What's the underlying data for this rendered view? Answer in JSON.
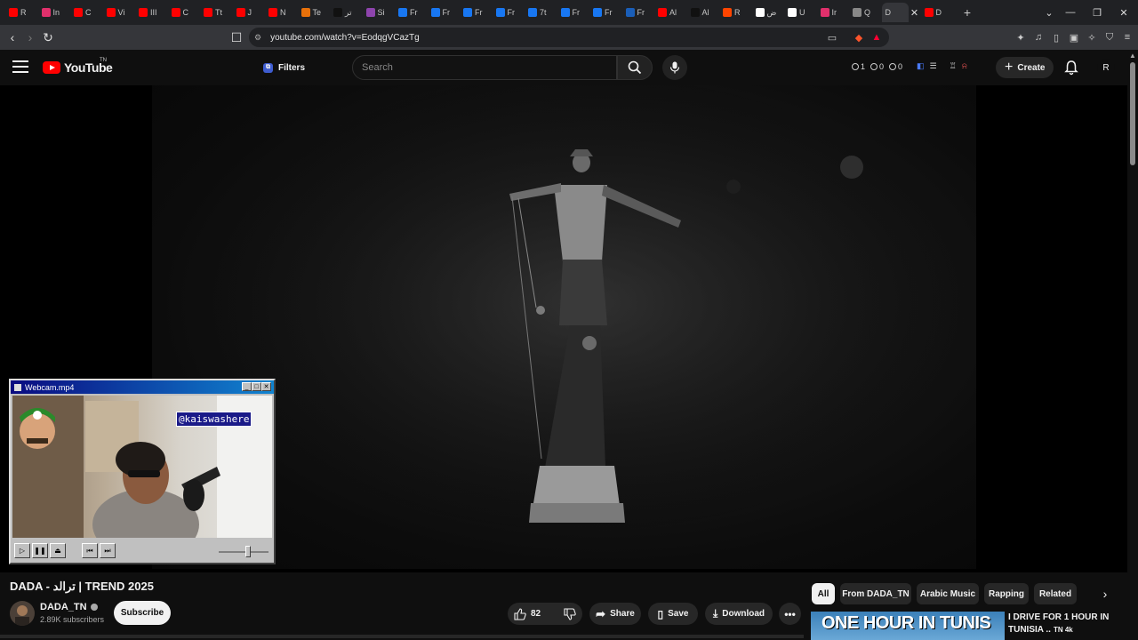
{
  "browser": {
    "tabs": [
      {
        "label": "R",
        "color": "#ff0000"
      },
      {
        "label": "In",
        "color": "#e1306c"
      },
      {
        "label": "C",
        "color": "#ff0000"
      },
      {
        "label": "Vi",
        "color": "#ff0000"
      },
      {
        "label": "III",
        "color": "#ff0000"
      },
      {
        "label": "C",
        "color": "#ff0000"
      },
      {
        "label": "Tt",
        "color": "#ff0000"
      },
      {
        "label": "J",
        "color": "#ff0000"
      },
      {
        "label": "N",
        "color": "#ff0000"
      },
      {
        "label": "Te",
        "color": "#e8710a"
      },
      {
        "label": "تر",
        "color": "#111111"
      },
      {
        "label": "Si",
        "color": "#8e44ad"
      },
      {
        "label": "Fr",
        "color": "#1877f2"
      },
      {
        "label": "Fr",
        "color": "#1877f2"
      },
      {
        "label": "Fr",
        "color": "#1877f2"
      },
      {
        "label": "Fr",
        "color": "#1877f2"
      },
      {
        "label": "7t",
        "color": "#1877f2"
      },
      {
        "label": "Fr",
        "color": "#1877f2"
      },
      {
        "label": "Fr",
        "color": "#1877f2"
      },
      {
        "label": "Fr",
        "color": "#1a5eb8"
      },
      {
        "label": "Al",
        "color": "#ff0000"
      },
      {
        "label": "Al",
        "color": "#111111"
      },
      {
        "label": "R",
        "color": "#ff4500"
      },
      {
        "label": "ض",
        "color": "#ffffff"
      },
      {
        "label": "U",
        "color": "#ffffff"
      },
      {
        "label": "Ir",
        "color": "#e1306c"
      },
      {
        "label": "Q",
        "color": "#888888"
      }
    ],
    "active_tab": {
      "label": "D"
    },
    "after_tab": {
      "label": "D",
      "color": "#ff0000"
    },
    "url": "youtube.com/watch?v=EodqgVCazTg"
  },
  "youtube": {
    "logo_text": "YouTube",
    "logo_tm": "TN",
    "filters_label": "Filters",
    "search_placeholder": "Search",
    "stats": {
      "a": "1",
      "b": "0",
      "c": "0"
    },
    "create_label": "Create",
    "avatar_letter": "R"
  },
  "webcam": {
    "title": "Webcam.mp4",
    "handle": "@kaiswashere",
    "volume_level": 0.6
  },
  "video": {
    "title": "DADA - ترالد | TREND 2025",
    "channel": "DADA_TN",
    "subscribers": "2.89K subscribers",
    "subscribe_label": "Subscribe",
    "likes": "82",
    "share_label": "Share",
    "save_label": "Save",
    "download_label": "Download"
  },
  "chips": [
    {
      "label": "All"
    },
    {
      "label": "From DADA_TN"
    },
    {
      "label": "Arabic Music"
    },
    {
      "label": "Rapping"
    },
    {
      "label": "Related"
    }
  ],
  "recommendation": {
    "thumb_text": "ONE HOUR IN TUNIS",
    "title_line1": "I DRIVE FOR 1 HOUR IN",
    "title_line2": "TUNISIA ..",
    "badge": "TN 4k"
  }
}
